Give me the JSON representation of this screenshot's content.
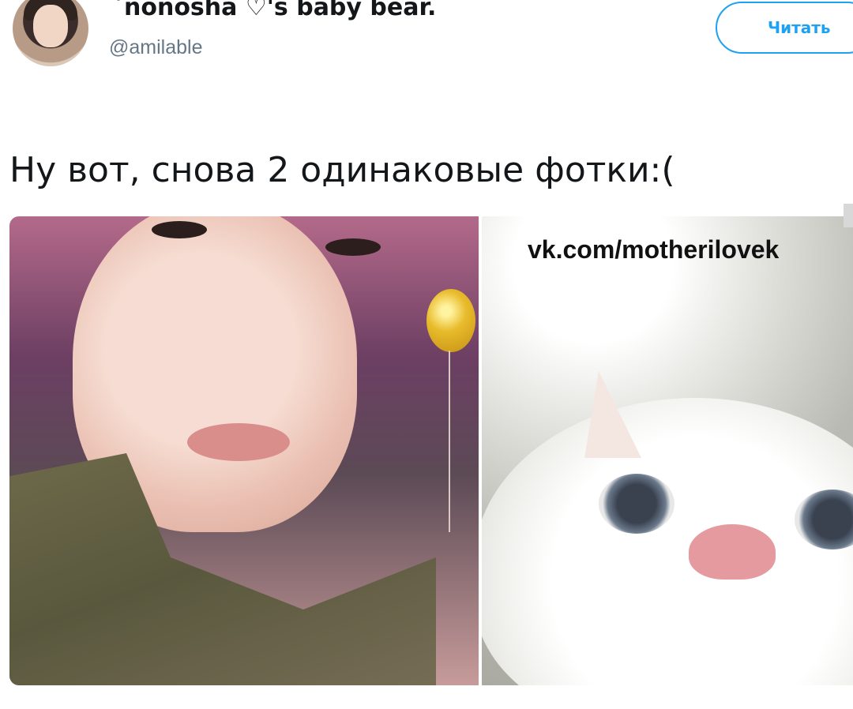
{
  "author": {
    "display_name": "`nonosha ♡'s baby bear.",
    "handle": "@amilable"
  },
  "follow_button": {
    "label": "Читать"
  },
  "tweet": {
    "text": "Ну вот, снова 2 одинаковые фотки:("
  },
  "media": {
    "left_photo": {
      "subject": "person-selfie"
    },
    "right_photo": {
      "subject": "cat-closeup",
      "watermark": "vk.com/motherilovek"
    }
  },
  "colors": {
    "accent": "#1da1f2",
    "text_primary": "#14171a",
    "text_secondary": "#657786"
  }
}
